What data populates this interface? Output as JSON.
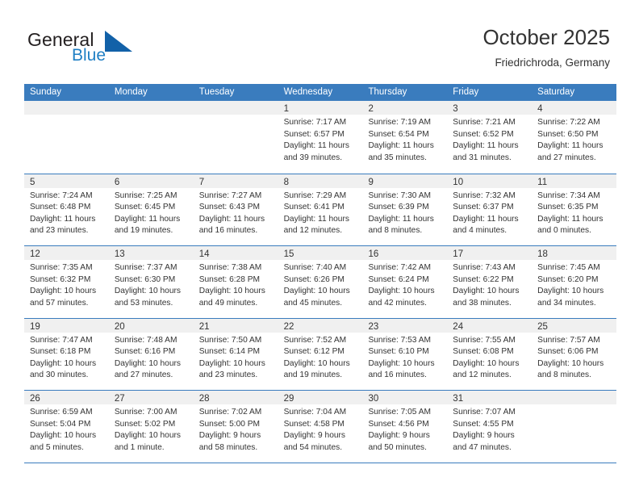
{
  "brand": {
    "name_part1": "General",
    "name_part2": "Blue",
    "logo_icon": "blue-triangle-icon",
    "accent_color": "#1f7fc4"
  },
  "header": {
    "title": "October 2025",
    "subtitle": "Friedrichroda, Germany"
  },
  "theme": {
    "header_blue": "#3a7cbe",
    "day_band_gray": "#f0f0f0",
    "text_color": "#333333"
  },
  "calendar": {
    "weekdays": [
      "Sunday",
      "Monday",
      "Tuesday",
      "Wednesday",
      "Thursday",
      "Friday",
      "Saturday"
    ],
    "weeks": [
      [
        {
          "day": "",
          "sunrise": "",
          "sunset": "",
          "daylight": "",
          "empty": true
        },
        {
          "day": "",
          "sunrise": "",
          "sunset": "",
          "daylight": "",
          "empty": true
        },
        {
          "day": "",
          "sunrise": "",
          "sunset": "",
          "daylight": "",
          "empty": true
        },
        {
          "day": "1",
          "sunrise": "Sunrise: 7:17 AM",
          "sunset": "Sunset: 6:57 PM",
          "daylight": "Daylight: 11 hours and 39 minutes."
        },
        {
          "day": "2",
          "sunrise": "Sunrise: 7:19 AM",
          "sunset": "Sunset: 6:54 PM",
          "daylight": "Daylight: 11 hours and 35 minutes."
        },
        {
          "day": "3",
          "sunrise": "Sunrise: 7:21 AM",
          "sunset": "Sunset: 6:52 PM",
          "daylight": "Daylight: 11 hours and 31 minutes."
        },
        {
          "day": "4",
          "sunrise": "Sunrise: 7:22 AM",
          "sunset": "Sunset: 6:50 PM",
          "daylight": "Daylight: 11 hours and 27 minutes."
        }
      ],
      [
        {
          "day": "5",
          "sunrise": "Sunrise: 7:24 AM",
          "sunset": "Sunset: 6:48 PM",
          "daylight": "Daylight: 11 hours and 23 minutes."
        },
        {
          "day": "6",
          "sunrise": "Sunrise: 7:25 AM",
          "sunset": "Sunset: 6:45 PM",
          "daylight": "Daylight: 11 hours and 19 minutes."
        },
        {
          "day": "7",
          "sunrise": "Sunrise: 7:27 AM",
          "sunset": "Sunset: 6:43 PM",
          "daylight": "Daylight: 11 hours and 16 minutes."
        },
        {
          "day": "8",
          "sunrise": "Sunrise: 7:29 AM",
          "sunset": "Sunset: 6:41 PM",
          "daylight": "Daylight: 11 hours and 12 minutes."
        },
        {
          "day": "9",
          "sunrise": "Sunrise: 7:30 AM",
          "sunset": "Sunset: 6:39 PM",
          "daylight": "Daylight: 11 hours and 8 minutes."
        },
        {
          "day": "10",
          "sunrise": "Sunrise: 7:32 AM",
          "sunset": "Sunset: 6:37 PM",
          "daylight": "Daylight: 11 hours and 4 minutes."
        },
        {
          "day": "11",
          "sunrise": "Sunrise: 7:34 AM",
          "sunset": "Sunset: 6:35 PM",
          "daylight": "Daylight: 11 hours and 0 minutes."
        }
      ],
      [
        {
          "day": "12",
          "sunrise": "Sunrise: 7:35 AM",
          "sunset": "Sunset: 6:32 PM",
          "daylight": "Daylight: 10 hours and 57 minutes."
        },
        {
          "day": "13",
          "sunrise": "Sunrise: 7:37 AM",
          "sunset": "Sunset: 6:30 PM",
          "daylight": "Daylight: 10 hours and 53 minutes."
        },
        {
          "day": "14",
          "sunrise": "Sunrise: 7:38 AM",
          "sunset": "Sunset: 6:28 PM",
          "daylight": "Daylight: 10 hours and 49 minutes."
        },
        {
          "day": "15",
          "sunrise": "Sunrise: 7:40 AM",
          "sunset": "Sunset: 6:26 PM",
          "daylight": "Daylight: 10 hours and 45 minutes."
        },
        {
          "day": "16",
          "sunrise": "Sunrise: 7:42 AM",
          "sunset": "Sunset: 6:24 PM",
          "daylight": "Daylight: 10 hours and 42 minutes."
        },
        {
          "day": "17",
          "sunrise": "Sunrise: 7:43 AM",
          "sunset": "Sunset: 6:22 PM",
          "daylight": "Daylight: 10 hours and 38 minutes."
        },
        {
          "day": "18",
          "sunrise": "Sunrise: 7:45 AM",
          "sunset": "Sunset: 6:20 PM",
          "daylight": "Daylight: 10 hours and 34 minutes."
        }
      ],
      [
        {
          "day": "19",
          "sunrise": "Sunrise: 7:47 AM",
          "sunset": "Sunset: 6:18 PM",
          "daylight": "Daylight: 10 hours and 30 minutes."
        },
        {
          "day": "20",
          "sunrise": "Sunrise: 7:48 AM",
          "sunset": "Sunset: 6:16 PM",
          "daylight": "Daylight: 10 hours and 27 minutes."
        },
        {
          "day": "21",
          "sunrise": "Sunrise: 7:50 AM",
          "sunset": "Sunset: 6:14 PM",
          "daylight": "Daylight: 10 hours and 23 minutes."
        },
        {
          "day": "22",
          "sunrise": "Sunrise: 7:52 AM",
          "sunset": "Sunset: 6:12 PM",
          "daylight": "Daylight: 10 hours and 19 minutes."
        },
        {
          "day": "23",
          "sunrise": "Sunrise: 7:53 AM",
          "sunset": "Sunset: 6:10 PM",
          "daylight": "Daylight: 10 hours and 16 minutes."
        },
        {
          "day": "24",
          "sunrise": "Sunrise: 7:55 AM",
          "sunset": "Sunset: 6:08 PM",
          "daylight": "Daylight: 10 hours and 12 minutes."
        },
        {
          "day": "25",
          "sunrise": "Sunrise: 7:57 AM",
          "sunset": "Sunset: 6:06 PM",
          "daylight": "Daylight: 10 hours and 8 minutes."
        }
      ],
      [
        {
          "day": "26",
          "sunrise": "Sunrise: 6:59 AM",
          "sunset": "Sunset: 5:04 PM",
          "daylight": "Daylight: 10 hours and 5 minutes."
        },
        {
          "day": "27",
          "sunrise": "Sunrise: 7:00 AM",
          "sunset": "Sunset: 5:02 PM",
          "daylight": "Daylight: 10 hours and 1 minute."
        },
        {
          "day": "28",
          "sunrise": "Sunrise: 7:02 AM",
          "sunset": "Sunset: 5:00 PM",
          "daylight": "Daylight: 9 hours and 58 minutes."
        },
        {
          "day": "29",
          "sunrise": "Sunrise: 7:04 AM",
          "sunset": "Sunset: 4:58 PM",
          "daylight": "Daylight: 9 hours and 54 minutes."
        },
        {
          "day": "30",
          "sunrise": "Sunrise: 7:05 AM",
          "sunset": "Sunset: 4:56 PM",
          "daylight": "Daylight: 9 hours and 50 minutes."
        },
        {
          "day": "31",
          "sunrise": "Sunrise: 7:07 AM",
          "sunset": "Sunset: 4:55 PM",
          "daylight": "Daylight: 9 hours and 47 minutes."
        },
        {
          "day": "",
          "sunrise": "",
          "sunset": "",
          "daylight": "",
          "empty": true
        }
      ]
    ]
  }
}
